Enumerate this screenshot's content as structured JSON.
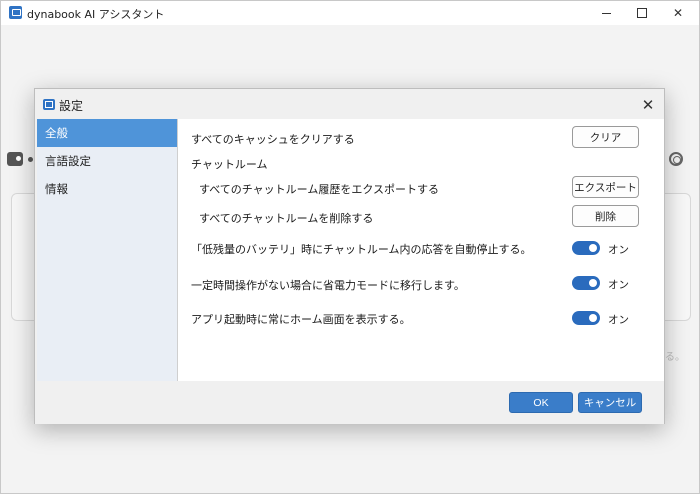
{
  "app": {
    "title": "dynabook AI アシスタント"
  },
  "dialog": {
    "title": "設定",
    "nav": [
      {
        "label": "全般",
        "active": true
      },
      {
        "label": "言語設定",
        "active": false
      },
      {
        "label": "情報",
        "active": false
      }
    ],
    "general": {
      "clear_cache_label": "すべてのキャッシュをクリアする",
      "clear_button": "クリア",
      "chatroom_heading": "チャットルーム",
      "export_label": "すべてのチャットルーム履歴をエクスポートする",
      "export_button": "エクスポート",
      "delete_label": "すべてのチャットルームを削除する",
      "delete_button": "削除",
      "toggles": [
        {
          "label": "「低残量のバッテリ」時にチャットルーム内の応答を自動停止する。",
          "state": "オン"
        },
        {
          "label": "一定時間操作がない場合に省電力モードに移行します。",
          "state": "オン"
        },
        {
          "label": "アプリ起動時に常にホーム画面を表示する。",
          "state": "オン"
        }
      ]
    },
    "footer": {
      "ok_button": "OK",
      "cancel_button": "キャンセル"
    }
  },
  "colors": {
    "accent": "#4f94d9",
    "toggle_on": "#2a6bbd",
    "primary_button": "#3a7dc9"
  }
}
